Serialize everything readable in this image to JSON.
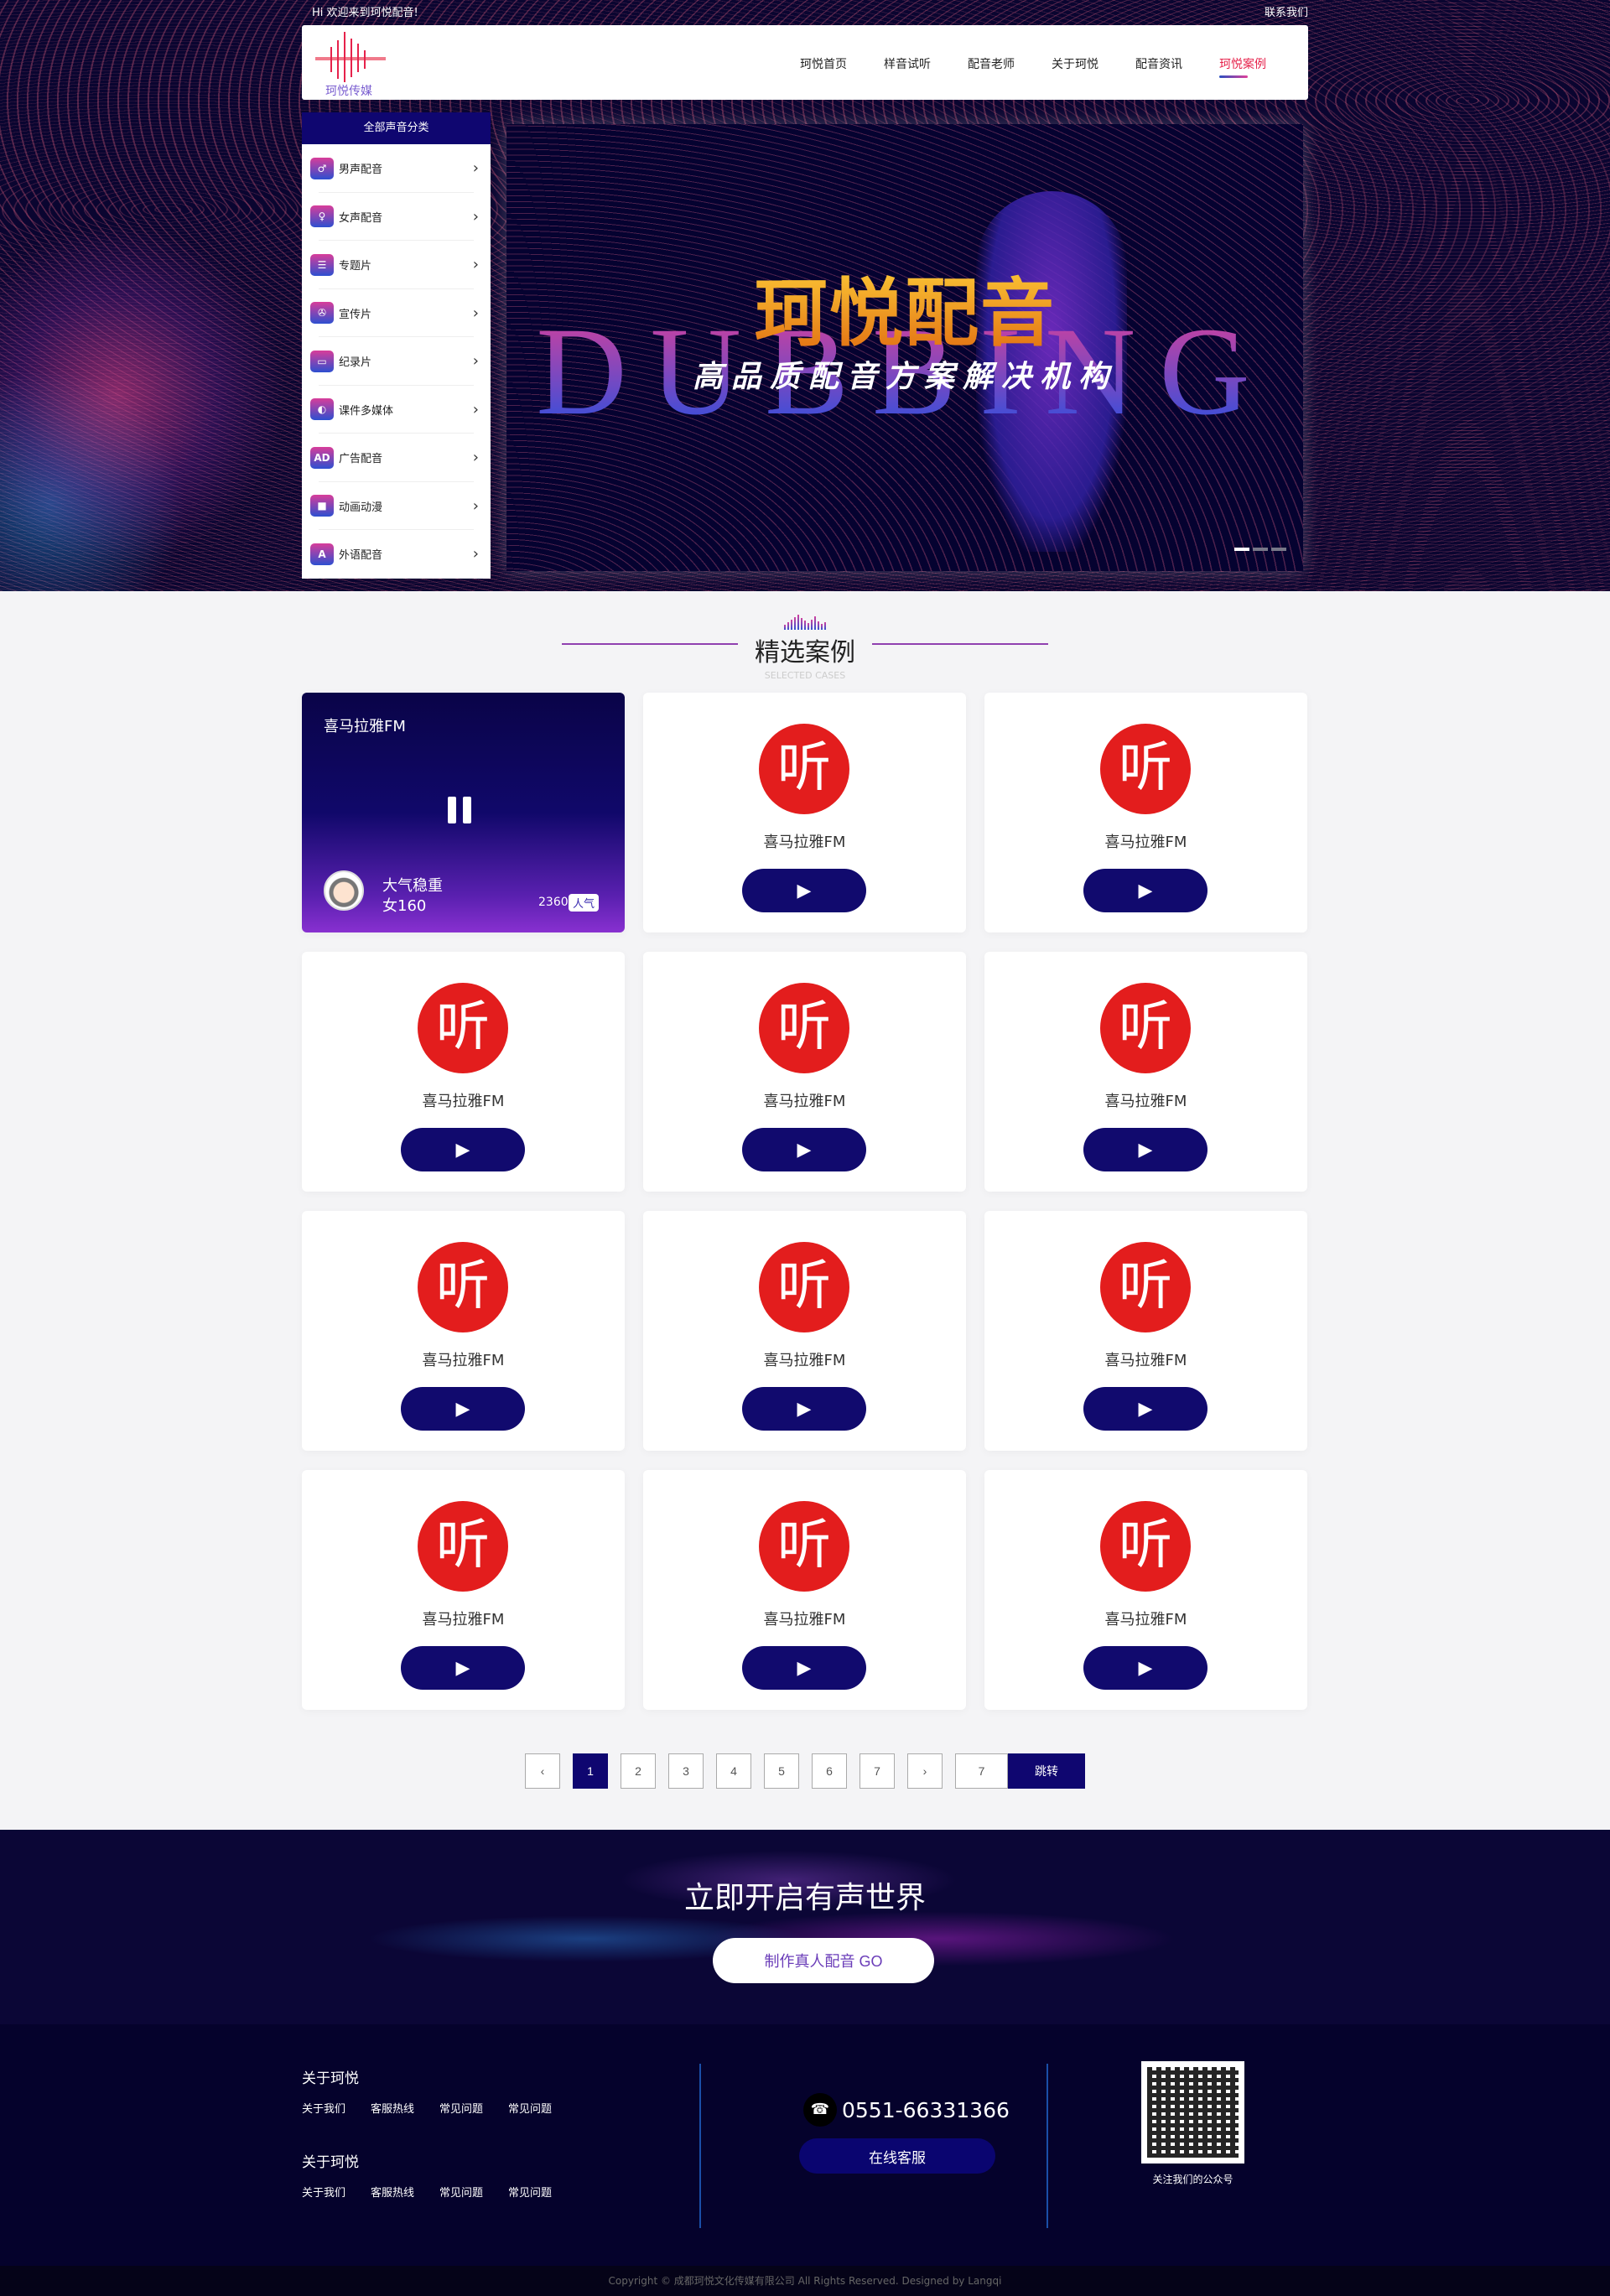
{
  "topbar": {
    "welcome": "Hi 欢迎来到珂悦配音!",
    "contact": "联系我们"
  },
  "logo": {
    "text": "珂悦传媒"
  },
  "nav": {
    "items": [
      {
        "label": "珂悦首页"
      },
      {
        "label": "样音试听"
      },
      {
        "label": "配音老师"
      },
      {
        "label": "关于珂悦"
      },
      {
        "label": "配音资讯"
      },
      {
        "label": "珂悦案例",
        "active": true
      }
    ]
  },
  "sidebar": {
    "title": "全部声音分类",
    "items": [
      {
        "label": "男声配音",
        "icon": "suit-icon",
        "glyph": "♂"
      },
      {
        "label": "女声配音",
        "icon": "dress-icon",
        "glyph": "♀"
      },
      {
        "label": "专题片",
        "icon": "folder-icon",
        "glyph": "☰"
      },
      {
        "label": "宣传片",
        "icon": "film-reel-icon",
        "glyph": "✇"
      },
      {
        "label": "纪录片",
        "icon": "screen-icon",
        "glyph": "▭"
      },
      {
        "label": "课件多媒体",
        "icon": "palette-icon",
        "glyph": "◐"
      },
      {
        "label": "广告配音",
        "icon": "ad-icon",
        "glyph": "AD"
      },
      {
        "label": "动画动漫",
        "icon": "video-camera-icon",
        "glyph": "■"
      },
      {
        "label": "外语配音",
        "icon": "letter-a-icon",
        "glyph": "A"
      }
    ]
  },
  "banner": {
    "title": "珂悦配音",
    "watermark": "DUBBING",
    "subtitle": "高品质配音方案解决机构",
    "slides": 3,
    "active_slide": 1
  },
  "section": {
    "title": "精选案例",
    "subtitle": "SELECTED CASES"
  },
  "cards": [
    {
      "name": "喜马拉雅FM",
      "active": true,
      "voice_style": "大气稳重",
      "voice_id": "女160",
      "count": "2360",
      "badge": "人气"
    },
    {
      "name": "喜马拉雅FM",
      "logo": "听"
    },
    {
      "name": "喜马拉雅FM",
      "logo": "听"
    },
    {
      "name": "喜马拉雅FM",
      "logo": "听"
    },
    {
      "name": "喜马拉雅FM",
      "logo": "听"
    },
    {
      "name": "喜马拉雅FM",
      "logo": "听"
    },
    {
      "name": "喜马拉雅FM",
      "logo": "听"
    },
    {
      "name": "喜马拉雅FM",
      "logo": "听"
    },
    {
      "name": "喜马拉雅FM",
      "logo": "听"
    },
    {
      "name": "喜马拉雅FM",
      "logo": "听"
    },
    {
      "name": "喜马拉雅FM",
      "logo": "听"
    },
    {
      "name": "喜马拉雅FM",
      "logo": "听"
    }
  ],
  "pagination": {
    "prev": "‹",
    "next": "›",
    "pages": [
      "1",
      "2",
      "3",
      "4",
      "5",
      "6",
      "7"
    ],
    "current": "1",
    "jump_value": "7",
    "jump_label": "跳转"
  },
  "cta": {
    "title": "立即开启有声世界",
    "button": "制作真人配音 GO"
  },
  "footer": {
    "groups": [
      {
        "title": "关于珂悦",
        "links": [
          "关于我们",
          "客服热线",
          "常见问题",
          "常见问题"
        ]
      },
      {
        "title": "关于珂悦",
        "links": [
          "关于我们",
          "客服热线",
          "常见问题",
          "常见问题"
        ]
      }
    ],
    "phone": "0551-66331366",
    "online_service": "在线客服",
    "qr_caption": "关注我们的公众号",
    "copyright": "Copyright © 成都珂悦文化传媒有限公司 All Rights Reserved. Designed by Langqi"
  },
  "colors": {
    "navy": "#0f0670",
    "accent_red": "#e6224b",
    "logo_red": "#e31d1d"
  }
}
